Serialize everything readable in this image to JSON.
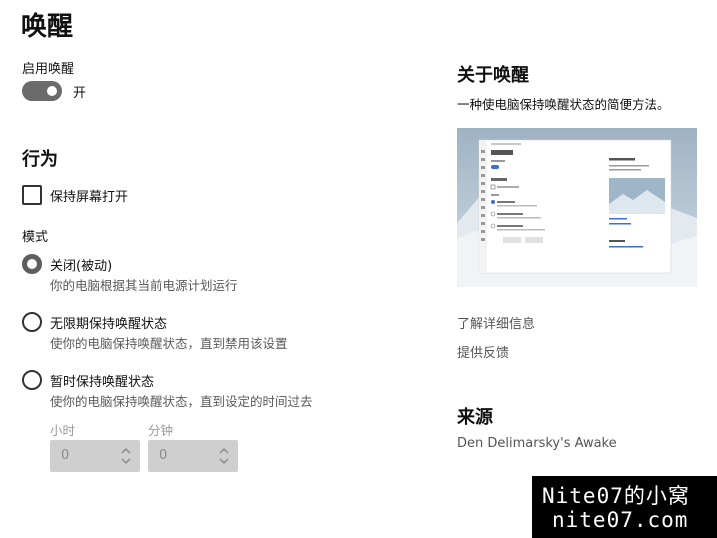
{
  "page": {
    "title": "唤醒"
  },
  "enable": {
    "label": "启用唤醒",
    "state_label": "开",
    "on": true
  },
  "behavior": {
    "title": "行为",
    "keep_screen_on_label": "保持屏幕打开",
    "keep_screen_on_checked": false,
    "mode_label": "模式",
    "modes": [
      {
        "title": "关闭(被动)",
        "desc": "你的电脑根据其当前电源计划运行",
        "checked": true
      },
      {
        "title": "无限期保持唤醒状态",
        "desc": "使你的电脑保持唤醒状态，直到禁用该设置",
        "checked": false
      },
      {
        "title": "暂时保持唤醒状态",
        "desc": "使你的电脑保持唤醒状态，直到设定的时间过去",
        "checked": false
      }
    ],
    "hours": {
      "label": "小时",
      "value": "0"
    },
    "minutes": {
      "label": "分钟",
      "value": "0"
    }
  },
  "about": {
    "title": "关于唤醒",
    "desc": "一种使电脑保持唤醒状态的简便方法。",
    "learn_more": "了解详细信息",
    "feedback": "提供反馈"
  },
  "source": {
    "title": "来源",
    "text": "Den Delimarsky's Awake"
  },
  "watermark": {
    "line1": "Nite07的小窝",
    "line2": "nite07.com"
  },
  "colors": {
    "toggle_on": "#6b6b6b",
    "radio_checked": "#5e5e5e",
    "spinbox_bg": "#cfcfcf",
    "link": "#555555"
  }
}
